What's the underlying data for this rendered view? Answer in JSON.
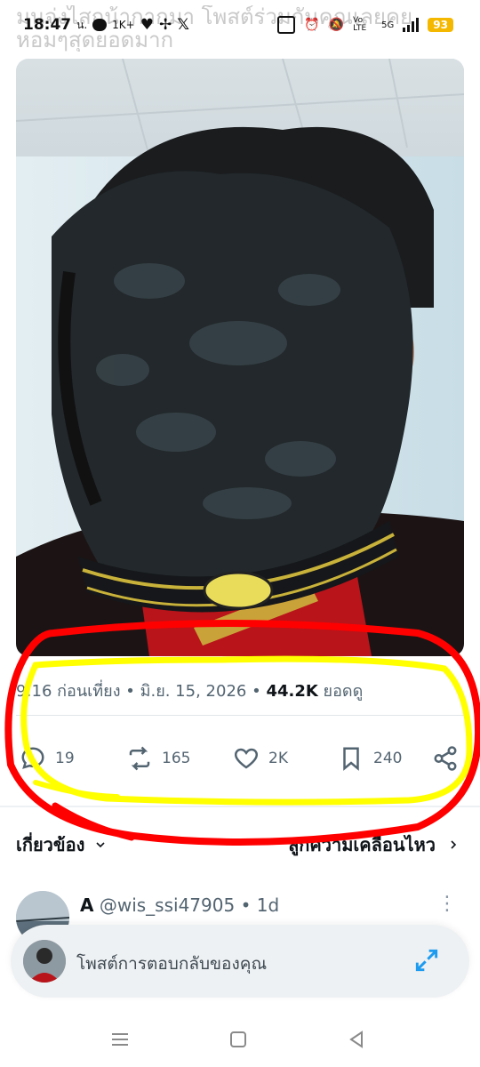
{
  "status_bar": {
    "time": "18:47",
    "time_suffix": "น.",
    "network_speed": "1K+",
    "lte_label": "Vo LTE",
    "signal_label": "5G",
    "battery": "93"
  },
  "background_text": {
    "line1": "มนจ่งไสกน้ากากมา โพสต์ร่วมกันคุณเลยคย",
    "line2": "หอมๆสุดยอดมาก"
  },
  "tweet": {
    "timestamp": "9:16 ก่อนเที่ยง",
    "separator": "•",
    "date": "มิ.ย. 15, 2026",
    "views_count": "44.2K",
    "views_label": "ยอดดู"
  },
  "actions": {
    "replies": "19",
    "retweets": "165",
    "likes": "2K",
    "bookmarks": "240"
  },
  "related": {
    "label": "เกี่ยวข้อง",
    "sensitive_label": "ลูกความเคลื่อนไหว"
  },
  "reply_preview": {
    "name": "A",
    "handle": "@wis_ssi47905",
    "separator": "•",
    "age": "1d"
  },
  "composer": {
    "placeholder": "โพสต์การตอบกลับของคุณ"
  },
  "colors": {
    "accent": "#1d9bf0",
    "muted": "#536471",
    "annotation_red": "#ff0000",
    "annotation_yellow": "#ffff00"
  }
}
